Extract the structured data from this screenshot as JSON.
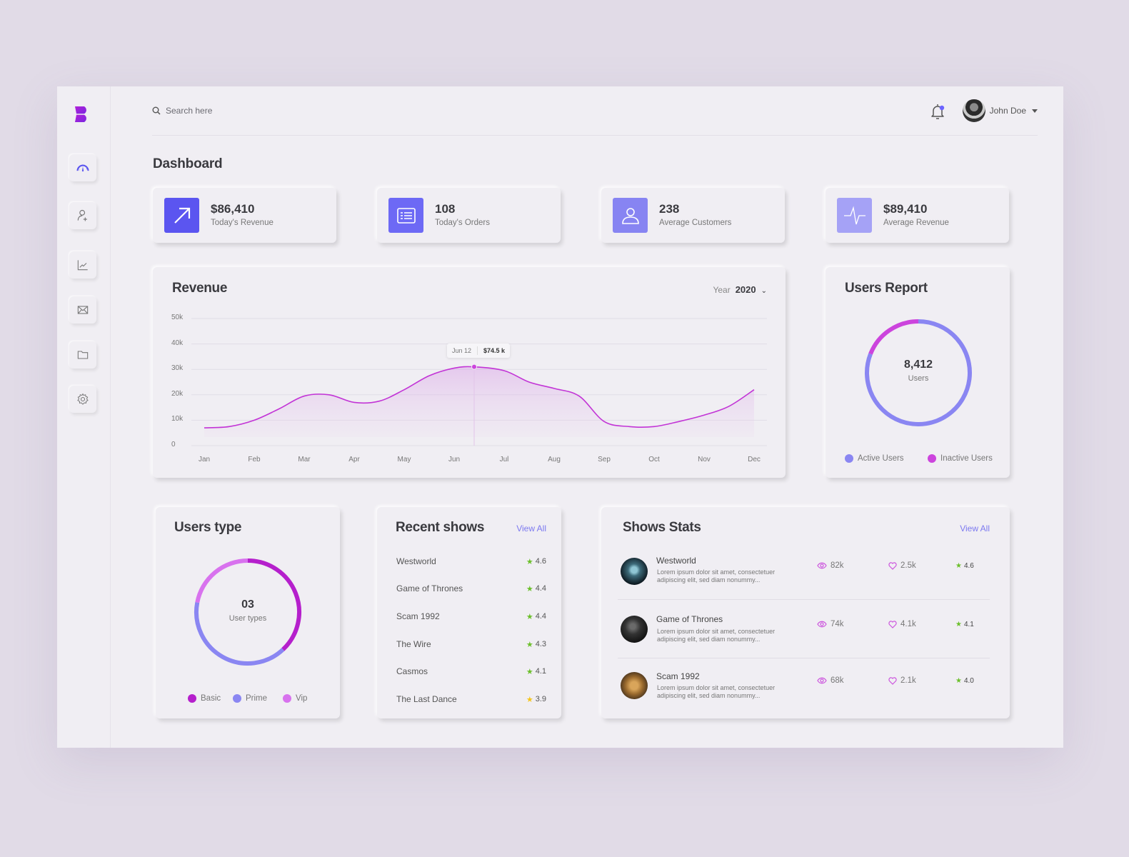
{
  "topbar": {
    "search_placeholder": "Search here",
    "user_name": "John Doe",
    "notification_dot_color": "#6c63ff"
  },
  "sidebar": {
    "items": [
      {
        "name": "dashboard",
        "icon": "gauge-icon",
        "active": true
      },
      {
        "name": "add-user",
        "icon": "user-plus-icon",
        "active": false
      },
      {
        "name": "analytics",
        "icon": "line-chart-icon",
        "active": false
      },
      {
        "name": "messages",
        "icon": "mail-icon",
        "active": false
      },
      {
        "name": "files",
        "icon": "folder-icon",
        "active": false
      },
      {
        "name": "settings",
        "icon": "gear-icon",
        "active": false
      }
    ]
  },
  "page": {
    "title": "Dashboard"
  },
  "stats": [
    {
      "value": "$86,410",
      "label": "Today's Revenue",
      "icon": "arrow-up-right-icon",
      "color": "#5b55f0"
    },
    {
      "value": "108",
      "label": "Today's Orders",
      "icon": "list-icon",
      "color": "#6d69f5"
    },
    {
      "value": "238",
      "label": "Average Customers",
      "icon": "user-icon",
      "color": "#8784f2"
    },
    {
      "value": "$89,410",
      "label": "Average Revenue",
      "icon": "pulse-icon",
      "color": "#a5a2f6"
    }
  ],
  "revenue": {
    "title": "Revenue",
    "year_label": "Year",
    "year_value": "2020",
    "tooltip": {
      "date": "Jun 12",
      "value": "$74.5 k"
    }
  },
  "chart_data": {
    "type": "area",
    "title": "Revenue",
    "categories": [
      "Jan",
      "Feb",
      "Mar",
      "Apr",
      "May",
      "Jun",
      "Jul",
      "Aug",
      "Sep",
      "Oct",
      "Nov",
      "Dec"
    ],
    "series": [
      {
        "name": "Revenue",
        "color": "#c234d6",
        "x": [
          0,
          0.5,
          1,
          1.5,
          2,
          2.5,
          3,
          3.5,
          4,
          4.5,
          5,
          5.4,
          6,
          6.5,
          7,
          7.5,
          8,
          8.5,
          9,
          9.5,
          10,
          10.5,
          11
        ],
        "values": [
          7,
          7.5,
          10,
          14.5,
          19.5,
          20,
          17,
          17.5,
          22,
          27.5,
          30.5,
          31,
          29.5,
          25,
          22.5,
          19.5,
          9.5,
          7.5,
          7.5,
          9.5,
          12,
          15.5,
          22
        ]
      }
    ],
    "highlight": {
      "x": 5.4,
      "label": "Jun 12",
      "value_label": "$74.5 k"
    },
    "yticks": [
      "0",
      "10k",
      "20k",
      "30k",
      "40k",
      "50k"
    ],
    "ylim": [
      0,
      50
    ],
    "grid": true
  },
  "users_report": {
    "title": "Users Report",
    "total": "8,412",
    "total_label": "Users",
    "segments": [
      {
        "label": "Active Users",
        "color": "#8a86f2",
        "fraction": 0.81
      },
      {
        "label": "Inactive Users",
        "color": "#cc44dd",
        "fraction": 0.19
      }
    ]
  },
  "users_type": {
    "title": "Users type",
    "total": "03",
    "total_label": "User types",
    "segments": [
      {
        "label": "Basic",
        "color": "#b51fcc",
        "fraction": 0.38
      },
      {
        "label": "Prime",
        "color": "#8a86f2",
        "fraction": 0.4
      },
      {
        "label": "Vip",
        "color": "#d872ee",
        "fraction": 0.22
      }
    ]
  },
  "recent_shows": {
    "title": "Recent shows",
    "view_all": "View All",
    "items": [
      {
        "name": "Westworld",
        "rating": "4.6",
        "star_color": "#6bbf2a"
      },
      {
        "name": "Game of Thrones",
        "rating": "4.4",
        "star_color": "#6bbf2a"
      },
      {
        "name": "Scam 1992",
        "rating": "4.4",
        "star_color": "#6bbf2a"
      },
      {
        "name": "The Wire",
        "rating": "4.3",
        "star_color": "#6bbf2a"
      },
      {
        "name": "Casmos",
        "rating": "4.1",
        "star_color": "#6bbf2a"
      },
      {
        "name": "The Last Dance",
        "rating": "3.9",
        "star_color": "#f5c518"
      }
    ]
  },
  "shows_stats": {
    "title": "Shows Stats",
    "view_all": "View All",
    "items": [
      {
        "name": "Westworld",
        "desc": "Lorem ipsum dolor sit amet, consectetuer adipiscing elit, sed diam nonummy...",
        "views": "82k",
        "likes": "2.5k",
        "rating": "4.6"
      },
      {
        "name": "Game of Thrones",
        "desc": "Lorem ipsum dolor sit amet, consectetuer adipiscing elit, sed diam nonummy...",
        "views": "74k",
        "likes": "4.1k",
        "rating": "4.1"
      },
      {
        "name": "Scam 1992",
        "desc": "Lorem ipsum dolor sit amet, consectetuer adipiscing elit, sed diam nonummy...",
        "views": "68k",
        "likes": "2.1k",
        "rating": "4.0"
      }
    ]
  }
}
